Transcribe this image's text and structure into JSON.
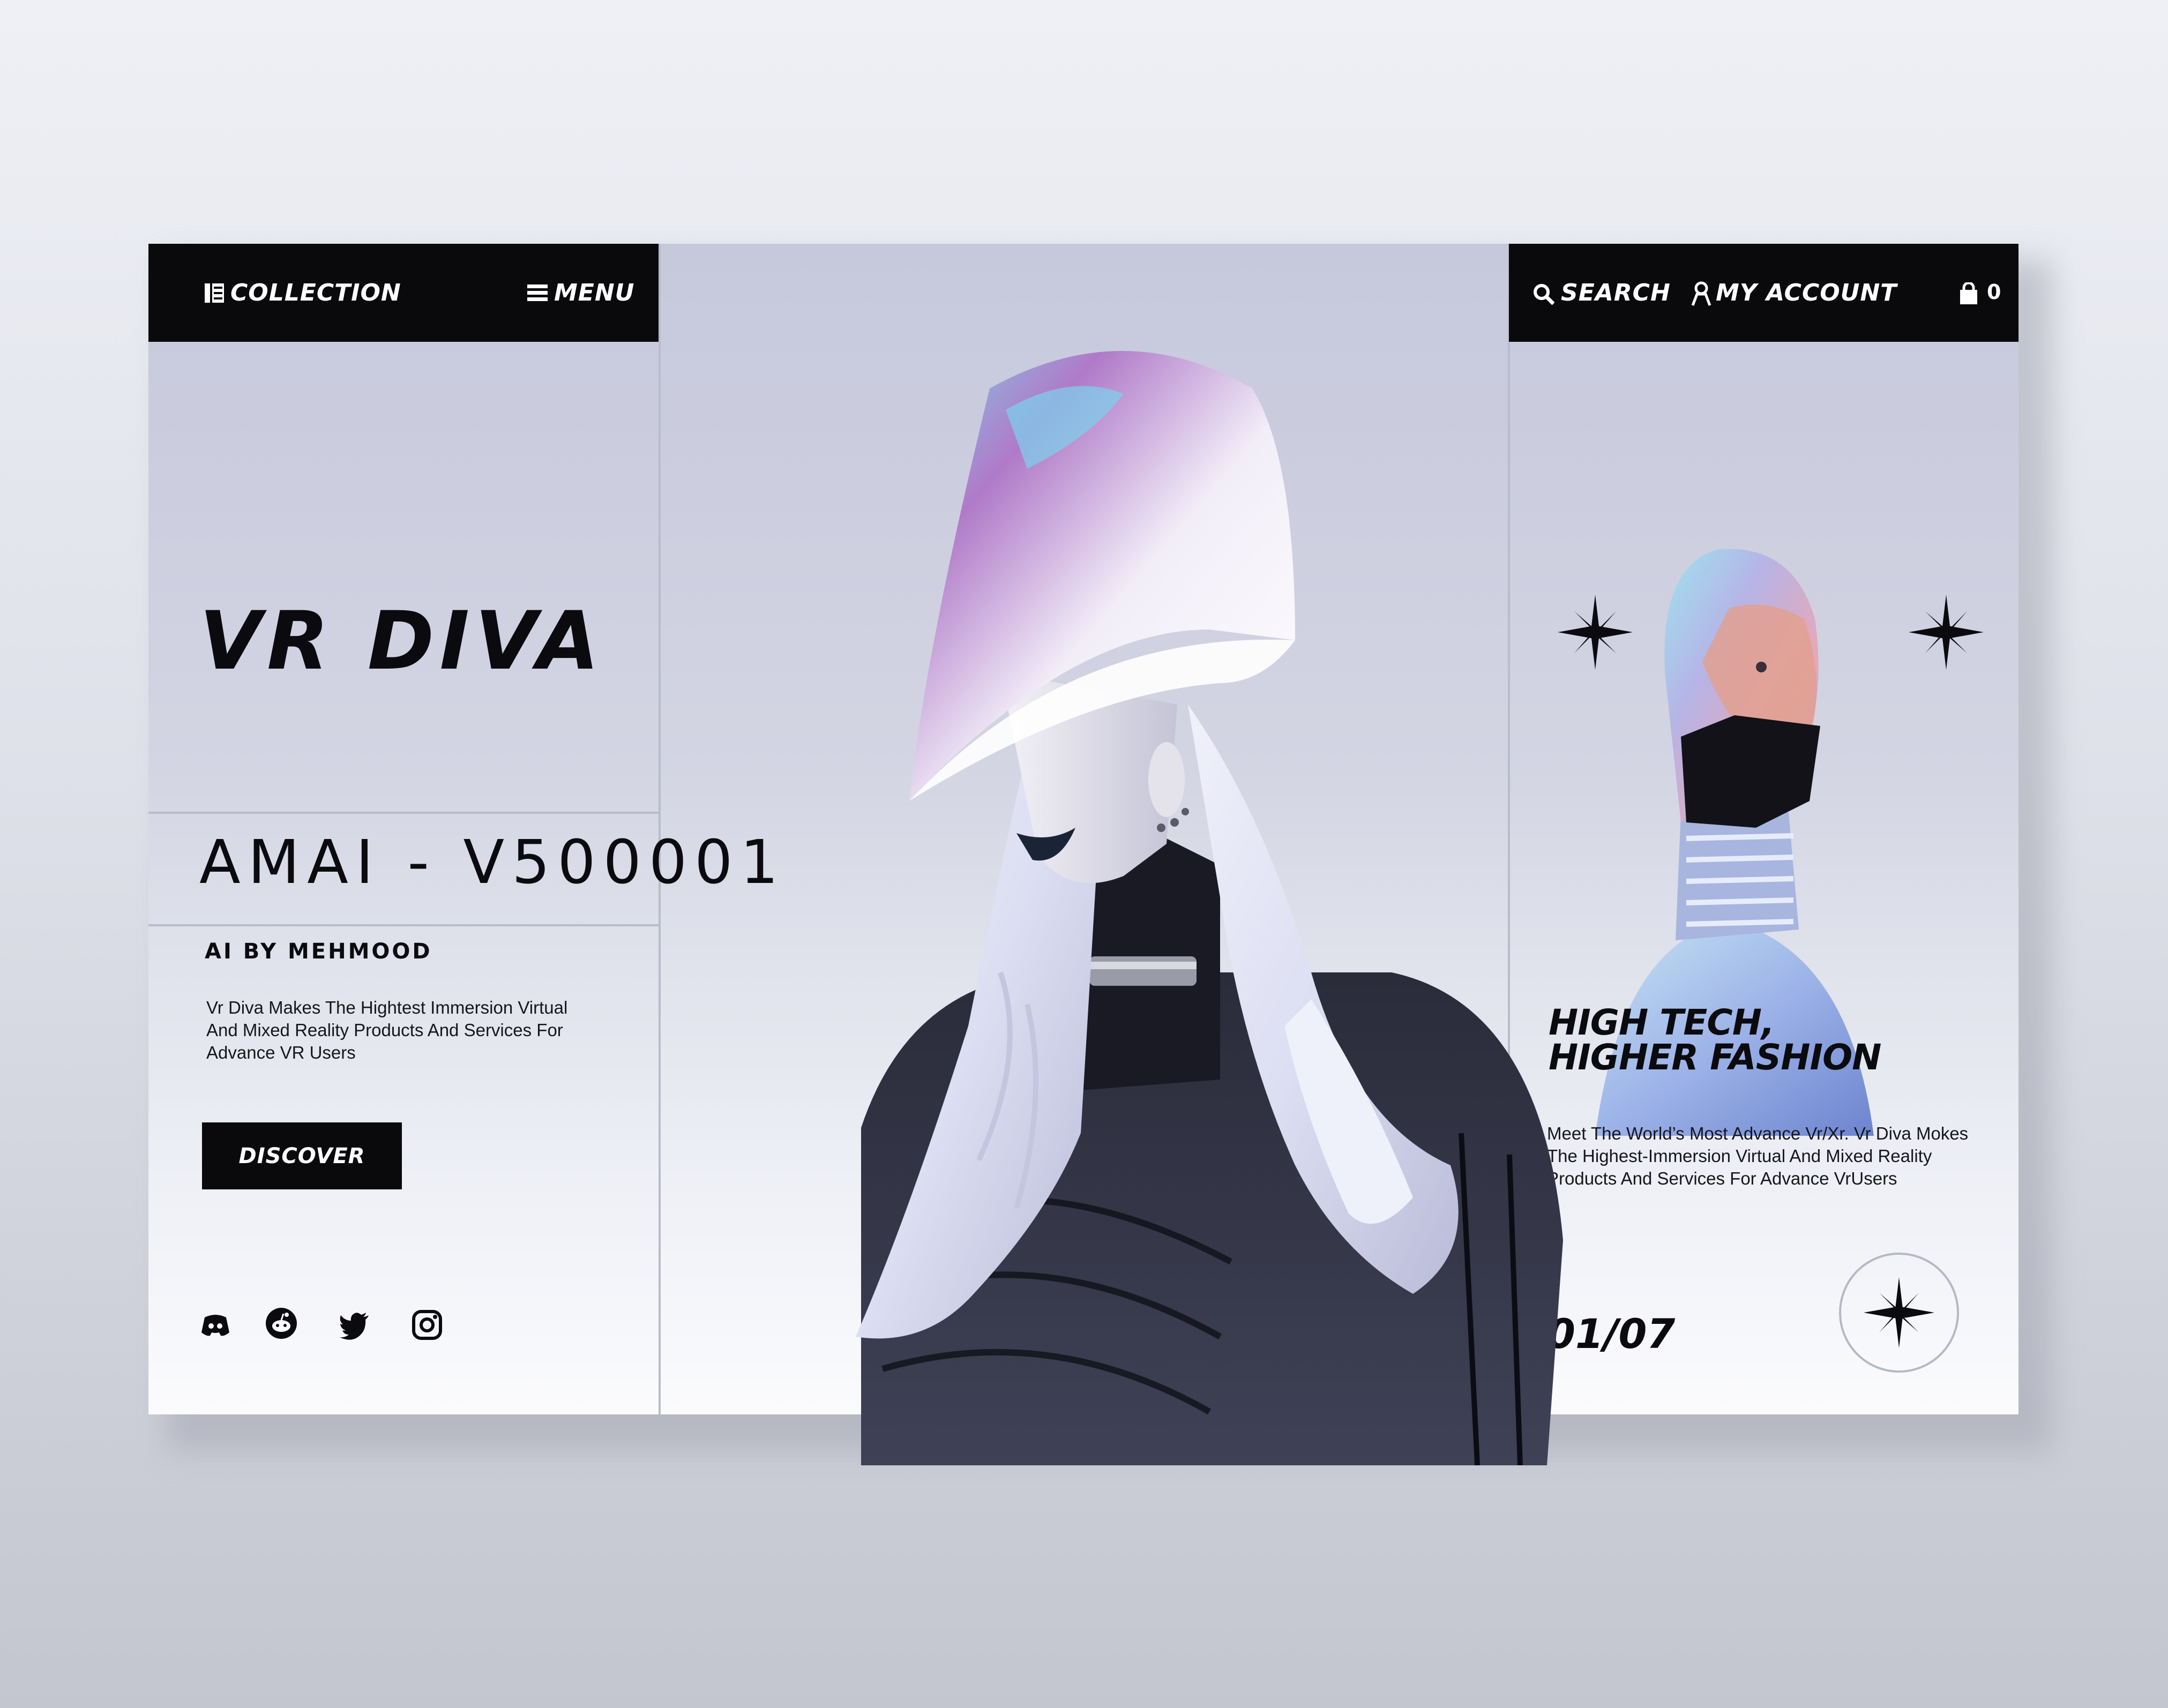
{
  "nav": {
    "collection_label": "COLLECTION",
    "menu_label": "MENU",
    "search_label": "SEARCH",
    "account_label": "MY ACCOUNT",
    "cart_count": "0"
  },
  "hero": {
    "brand_title": "VR DIVA",
    "model_title": "AMAI - V500001",
    "author": "AI BY MEHMOOD",
    "description": "Vr Diva Makes The Hightest Immersion Virtual And Mixed Reality Products And Services For Advance VR Users",
    "cta_label": "DISCOVER"
  },
  "social": {
    "icons": [
      "discord-icon",
      "reddit-icon",
      "twitter-icon",
      "instagram-icon"
    ]
  },
  "side": {
    "headline_line1": "HIGH TECH,",
    "headline_line2": "HIGHER FASHION",
    "description": "Meet The World’s Most Advance Vr/Xr. Vr Diva Mokes The Highest-Immersion Virtual And Mixed Reality Products And Services For Advance VrUsers",
    "counter": "01/07"
  },
  "colors": {
    "primary": "#0a0a0d",
    "panel": "#d0d2e2",
    "accent_hair": "#dcdff3"
  }
}
